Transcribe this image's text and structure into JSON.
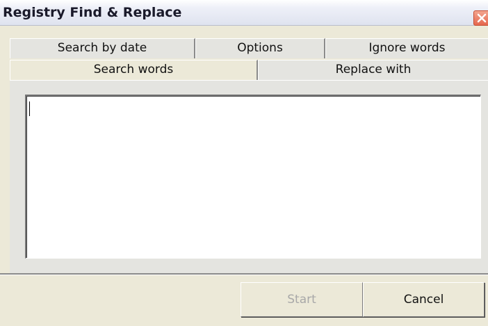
{
  "window": {
    "title": "Registry Find & Replace"
  },
  "tabs": {
    "back_row": [
      {
        "label": "Search by date"
      },
      {
        "label": "Options"
      },
      {
        "label": "Ignore words"
      }
    ],
    "front_row": [
      {
        "label": "Search words",
        "selected": true
      },
      {
        "label": "Replace with",
        "selected": false
      }
    ]
  },
  "search_words": {
    "value": ""
  },
  "buttons": {
    "start_label": "Start",
    "start_enabled": false,
    "cancel_label": "Cancel"
  },
  "icons": {
    "close": "close-icon"
  },
  "colors": {
    "dialog_bg": "#ece9d8",
    "close_button": "#e5674e"
  }
}
